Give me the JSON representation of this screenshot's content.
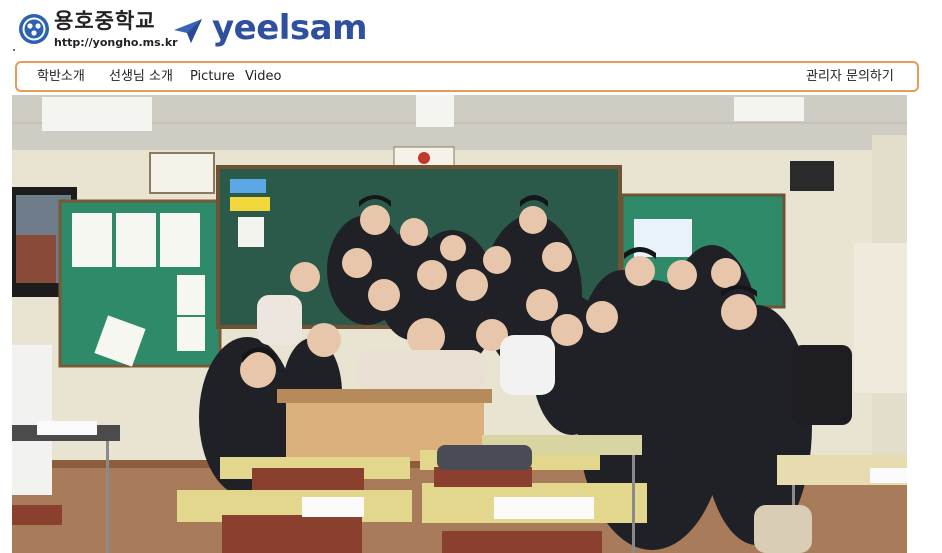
{
  "header": {
    "school_name": "용호중학교",
    "school_url": "http://yongho.ms.kr",
    "brand": "yeelsam",
    "logo_icon": "school-emblem-icon",
    "brand_icon": "paper-plane-icon",
    "brand_color": "#2f4f9f"
  },
  "nav": {
    "border_color": "#e59d57",
    "items": [
      {
        "label": "학반소개"
      },
      {
        "label": "선생님 소개"
      },
      {
        "label": "Picture"
      },
      {
        "label": "Video"
      }
    ],
    "admin_label": "관리자 문의하기"
  },
  "photo": {
    "subject": "classroom-group-photo"
  }
}
